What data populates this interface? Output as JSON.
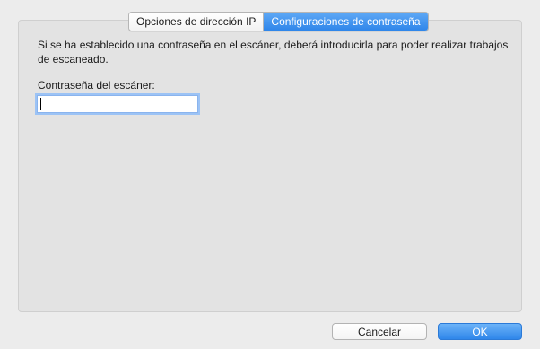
{
  "tabs": [
    {
      "label": "Opciones de dirección IP",
      "active": false
    },
    {
      "label": "Configuraciones de contraseña",
      "active": true
    }
  ],
  "content": {
    "description": "Si se ha establecido una contraseña en el escáner, deberá introducirla para poder realizar trabajos de escaneado.",
    "password_label": "Contraseña del escáner:",
    "password_value": ""
  },
  "buttons": {
    "cancel_label": "Cancelar",
    "ok_label": "OK"
  },
  "colors": {
    "accent": "#2f86ea",
    "background": "#ececec",
    "panel": "#e3e3e3"
  }
}
